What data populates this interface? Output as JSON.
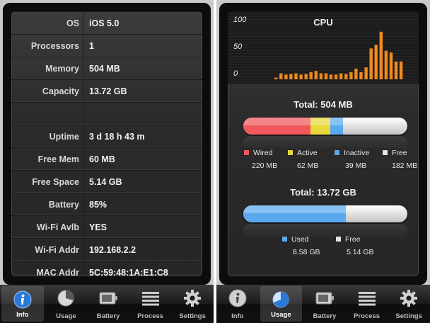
{
  "info": {
    "rows": [
      {
        "key": "OS",
        "value": "iOS 5.0"
      },
      {
        "key": "Processors",
        "value": "1"
      },
      {
        "key": "Memory",
        "value": "504 MB"
      },
      {
        "key": "Capacity",
        "value": "13.72 GB"
      },
      {
        "key": "",
        "value": ""
      },
      {
        "key": "Uptime",
        "value": "3 d 18 h 43 m"
      },
      {
        "key": "Free Mem",
        "value": "60 MB"
      },
      {
        "key": "Free Space",
        "value": "5.14 GB"
      },
      {
        "key": "Battery",
        "value": "85%"
      },
      {
        "key": "Wi-Fi Avlb",
        "value": "YES"
      },
      {
        "key": "Wi-Fi Addr",
        "value": "192.168.2.2"
      },
      {
        "key": "MAC Addr",
        "value": "5C:59:48:1A:E1:C8"
      }
    ]
  },
  "usage": {
    "cpu": {
      "title": "CPU",
      "ticks": [
        "100",
        "50",
        "0"
      ]
    },
    "memory": {
      "total_label": "Total: 504 MB",
      "legend": [
        {
          "name": "Wired",
          "value": "220 MB",
          "color": "#f0585c"
        },
        {
          "name": "Active",
          "value": "62 MB",
          "color": "#e8d83a"
        },
        {
          "name": "Inactive",
          "value": "39 MB",
          "color": "#5aa9ef"
        },
        {
          "name": "Free",
          "value": "182 MB",
          "color": "#e6e6e6"
        }
      ]
    },
    "storage": {
      "total_label": "Total: 13.72 GB",
      "legend": [
        {
          "name": "Used",
          "value": "8.58 GB",
          "color": "#5aa9ef"
        },
        {
          "name": "Free",
          "value": "5.14 GB",
          "color": "#e6e6e6"
        }
      ]
    }
  },
  "chart_data": {
    "type": "bar",
    "title": "CPU",
    "ylim": [
      0,
      100
    ],
    "yticks": [
      0,
      50,
      100
    ],
    "color": "#f08a1e",
    "values": [
      3,
      10,
      8,
      9,
      10,
      8,
      9,
      12,
      14,
      10,
      10,
      8,
      8,
      10,
      9,
      12,
      18,
      12,
      20,
      52,
      58,
      80,
      48,
      45,
      30,
      30
    ]
  },
  "tabs_left": [
    {
      "label": "Info",
      "icon": "info-icon",
      "active": true
    },
    {
      "label": "Usage",
      "icon": "usage-pie-icon",
      "active": false
    },
    {
      "label": "Battery",
      "icon": "battery-icon",
      "active": false
    },
    {
      "label": "Process",
      "icon": "process-list-icon",
      "active": false
    },
    {
      "label": "Settings",
      "icon": "gear-icon",
      "active": false
    }
  ],
  "tabs_right": [
    {
      "label": "Info",
      "icon": "info-icon",
      "active": false
    },
    {
      "label": "Usage",
      "icon": "usage-pie-icon",
      "active": true
    },
    {
      "label": "Battery",
      "icon": "battery-icon",
      "active": false
    },
    {
      "label": "Process",
      "icon": "process-list-icon",
      "active": false
    },
    {
      "label": "Settings",
      "icon": "gear-icon",
      "active": false
    }
  ]
}
